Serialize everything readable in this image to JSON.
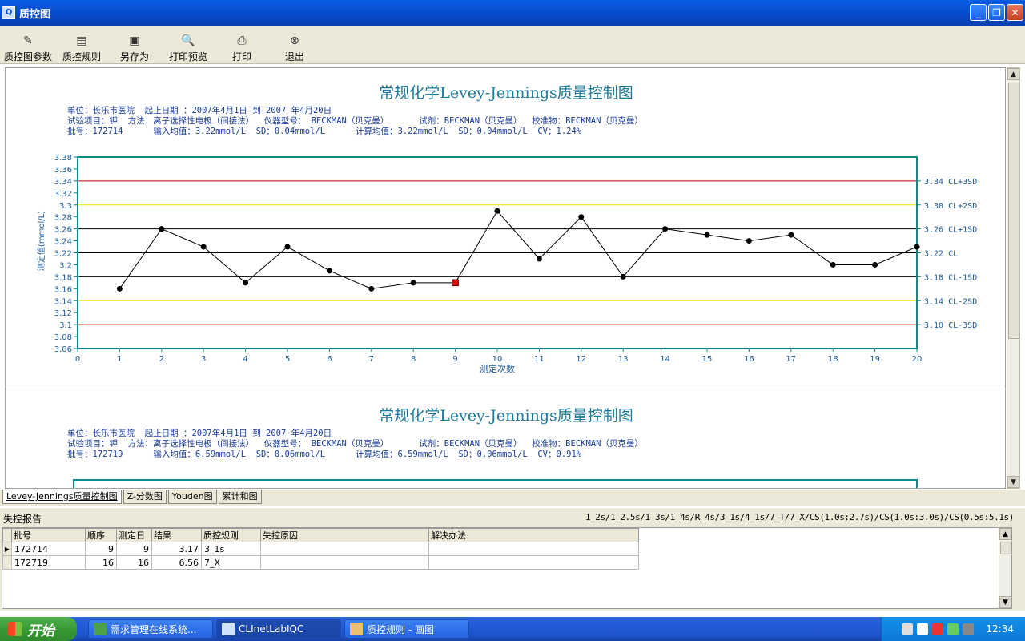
{
  "window": {
    "title": "质控图",
    "app_icon": "Q"
  },
  "toolbar": [
    {
      "label": "质控图参数",
      "icon": "pencil-icon"
    },
    {
      "label": "质控规则",
      "icon": "list-icon"
    },
    {
      "label": "另存为",
      "icon": "save-icon"
    },
    {
      "label": "打印预览",
      "icon": "print-preview-icon"
    },
    {
      "label": "打印",
      "icon": "printer-icon"
    },
    {
      "label": "退出",
      "icon": "exit-icon"
    }
  ],
  "panels": [
    {
      "title": "常规化学Levey-Jennings质量控制图",
      "info1": "单位：长乐市医院  起止日期 ：2007年4月1日 到 2007 年4月20日",
      "info2": "试验项目：钾  方法：离子选择性电极（间接法）  仪器型号： BECKMAN（贝克曼）      试剂：BECKMAN（贝克曼）  校准物：BECKMAN（贝克曼）",
      "info3": "批号：172714      输入均值：3.22mmol/L  SD：0.04mmol/L      计算均值：3.22mmol/L  SD：0.04mmol/L  CV：1.24%"
    },
    {
      "title": "常规化学Levey-Jennings质量控制图",
      "info1": "单位：长乐市医院  起止日期 ：2007年4月1日 到 2007 年4月20日",
      "info2": "试验项目：钾  方法：离子选择性电极（间接法）  仪器型号： BECKMAN（贝克曼）      试剂：BECKMAN（贝克曼）  校准物：BECKMAN（贝克曼）",
      "info3": "批号：172719      输入均值：6.59mmol/L  SD：0.06mmol/L      计算均值：6.59mmol/L  SD：0.06mmol/L  CV：0.91%"
    }
  ],
  "chart_data": {
    "type": "line",
    "xlabel": "测定次数",
    "ylabel": "测定值(mmol/L)",
    "xlim": [
      0,
      20
    ],
    "ylim": [
      3.06,
      3.38
    ],
    "x_ticks": [
      0,
      1,
      2,
      3,
      4,
      5,
      6,
      7,
      8,
      9,
      10,
      11,
      12,
      13,
      14,
      15,
      16,
      17,
      18,
      19,
      20
    ],
    "y_ticks": [
      "3.38",
      "3.36",
      "3.34",
      "3.32",
      "3.3",
      "3.28",
      "3.26",
      "3.24",
      "3.22",
      "3.2",
      "3.18",
      "3.16",
      "3.14",
      "3.12",
      "3.1",
      "3.08",
      "3.06"
    ],
    "reference_lines": [
      {
        "value": 3.34,
        "label": "3.34 CL+3SD",
        "color": "#cc0000"
      },
      {
        "value": 3.3,
        "label": "3.30 CL+2SD",
        "color": "#f0e000"
      },
      {
        "value": 3.26,
        "label": "3.26 CL+1SD",
        "color": "#000000"
      },
      {
        "value": 3.22,
        "label": "3.22 CL",
        "color": "#000000"
      },
      {
        "value": 3.18,
        "label": "3.18 CL-1SD",
        "color": "#000000"
      },
      {
        "value": 3.14,
        "label": "3.14 CL-2SD",
        "color": "#f0e000"
      },
      {
        "value": 3.1,
        "label": "3.10 CL-3SD",
        "color": "#cc0000"
      }
    ],
    "x": [
      1,
      2,
      3,
      4,
      5,
      6,
      7,
      8,
      9,
      10,
      11,
      12,
      13,
      14,
      15,
      16,
      17,
      18,
      19,
      20
    ],
    "y": [
      3.16,
      3.26,
      3.23,
      3.17,
      3.23,
      3.19,
      3.16,
      3.17,
      3.17,
      3.29,
      3.21,
      3.28,
      3.18,
      3.26,
      3.25,
      3.24,
      3.25,
      3.2,
      3.2,
      3.23
    ],
    "flagged_x": [
      9
    ],
    "colors": {
      "axis": "#0a8a8a",
      "tick_text": "#1c5a9a",
      "point": "#000000",
      "flagged": "#dd0000"
    }
  },
  "tabs": [
    "Levey-Jennings质量控制图",
    "Z-分数图",
    "Youden图",
    "累计和图"
  ],
  "report": {
    "header": "失控报告",
    "rules": "1_2s/1_2.5s/1_3s/1_4s/R_4s/3_1s/4_1s/7_T/7_X/CS(1.0s:2.7s)/CS(1.0s:3.0s)/CS(0.5s:5.1s)",
    "columns": [
      "批号",
      "顺序",
      "测定日",
      "结果",
      "质控规则",
      "失控原因",
      "解决办法"
    ],
    "rows": [
      [
        "172714",
        "9",
        "9",
        "3.17",
        "3_1s",
        "",
        ""
      ],
      [
        "172719",
        "16",
        "16",
        "6.56",
        "7_X",
        "",
        ""
      ]
    ]
  },
  "taskbar": {
    "start": "开始",
    "tasks": [
      "需求管理在线系统...",
      "CLInetLabIQC",
      "质控规则 - 画图"
    ],
    "clock": "12:34"
  }
}
